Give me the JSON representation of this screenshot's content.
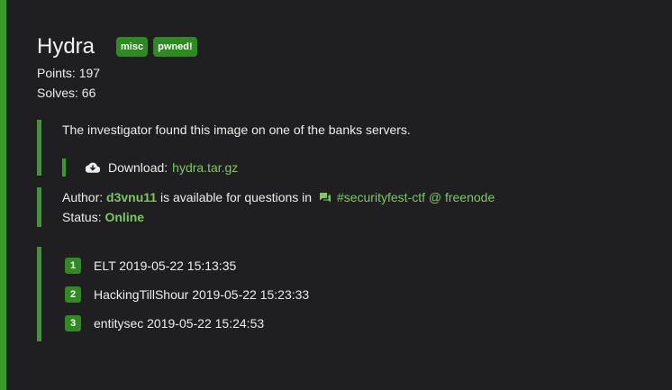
{
  "challenge": {
    "title": "Hydra",
    "tags": [
      "misc",
      "pwned!"
    ],
    "points_label": "Points: 197",
    "solves_label": "Solves: 66"
  },
  "description": {
    "text": "The investigator found this image on one of the banks servers.",
    "download_label": "Download:",
    "download_file": "hydra.tar.gz",
    "download_icon": "cloud-download-icon"
  },
  "author": {
    "prefix": "Author:",
    "name": "d3vnu11",
    "middle": "is available for questions in",
    "chat_icon": "chat-icon",
    "channel": "#securityfest-ctf @ freenode",
    "status_label": "Status:",
    "status_value": "Online"
  },
  "solves": [
    {
      "rank": "1",
      "text": "ELT 2019-05-22 15:13:35"
    },
    {
      "rank": "2",
      "text": "HackingTillShour 2019-05-22 15:23:33"
    },
    {
      "rank": "3",
      "text": "entitysec 2019-05-22 15:24:53"
    }
  ],
  "colors": {
    "accent": "#3b9b2a",
    "badge": "#2f8a22",
    "link": "#7dc85f",
    "background": "#1f1f21",
    "text": "#ececec"
  }
}
